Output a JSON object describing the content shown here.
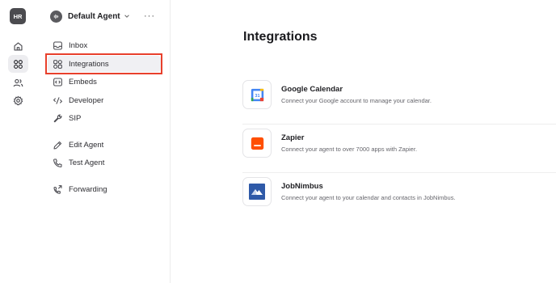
{
  "rail": {
    "avatar": "HR",
    "items": [
      {
        "icon": "home-icon"
      },
      {
        "icon": "apps-grid-icon",
        "active": true
      },
      {
        "icon": "users-icon"
      },
      {
        "icon": "gear-icon"
      }
    ]
  },
  "sidebar": {
    "agent_name": "Default Agent",
    "more_label": "···",
    "items": [
      {
        "label": "Inbox",
        "icon": "inbox-icon"
      },
      {
        "label": "Integrations",
        "icon": "integrations-icon",
        "active": true
      },
      {
        "label": "Embeds",
        "icon": "embed-icon"
      },
      {
        "label": "Developer",
        "icon": "code-icon"
      },
      {
        "label": "SIP",
        "icon": "wrench-icon"
      },
      {
        "label": "Edit Agent",
        "icon": "pencil-icon"
      },
      {
        "label": "Test Agent",
        "icon": "phone-icon"
      },
      {
        "label": "Forwarding",
        "icon": "phone-forward-icon"
      }
    ]
  },
  "main": {
    "title": "Integrations",
    "integrations": [
      {
        "name": "Google Calendar",
        "description": "Connect your Google account to manage your calendar.",
        "logo": "google-calendar-logo",
        "logo_text": "31"
      },
      {
        "name": "Zapier",
        "description": "Connect your agent to over 7000 apps with Zapier.",
        "logo": "zapier-logo"
      },
      {
        "name": "JobNimbus",
        "description": "Connect your agent to your calendar and contacts in JobNimbus.",
        "logo": "jobnimbus-logo"
      }
    ]
  },
  "colors": {
    "highlight": "#e8402c",
    "zapier": "#ff4f00",
    "jobnimbus": "#2f5aa8",
    "gcal_blue": "#4285f4"
  }
}
